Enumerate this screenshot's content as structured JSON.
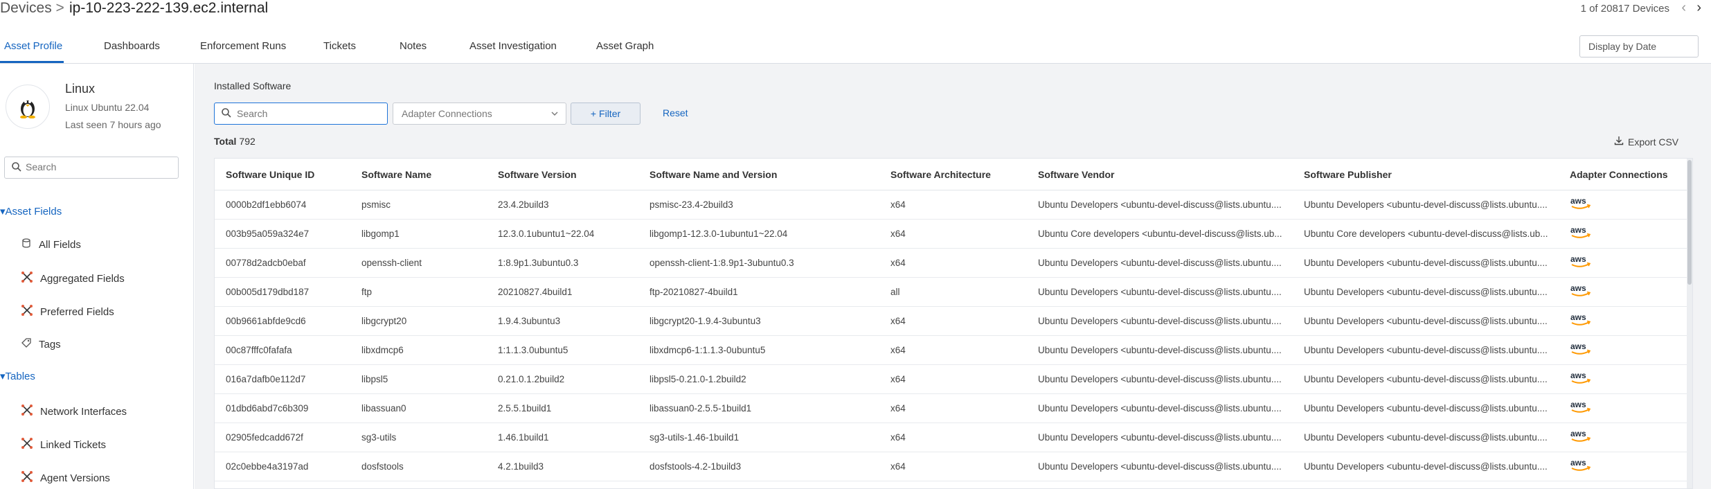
{
  "breadcrumb": {
    "root": "Devices",
    "separator": ">",
    "current": "ip-10-223-222-139.ec2.internal"
  },
  "pager": {
    "text": "1 of 20817 Devices"
  },
  "tabs": [
    {
      "label": "Asset Profile",
      "active": true
    },
    {
      "label": "Dashboards"
    },
    {
      "label": "Enforcement Runs"
    },
    {
      "label": "Tickets"
    },
    {
      "label": "Notes"
    },
    {
      "label": "Asset Investigation"
    },
    {
      "label": "Asset Graph"
    }
  ],
  "date_button": "Display by Date",
  "device": {
    "os_name": "Linux",
    "os_version": "Linux Ubuntu 22.04",
    "last_seen": "Last seen 7 hours ago"
  },
  "sidebar": {
    "search_placeholder": "Search",
    "sections": [
      {
        "title": "Asset Fields",
        "items": [
          {
            "label": "All Fields",
            "icon": "database-icon"
          },
          {
            "label": "Aggregated Fields",
            "icon": "adapters-icon"
          },
          {
            "label": "Preferred Fields",
            "icon": "adapters-icon"
          },
          {
            "label": "Tags",
            "icon": "tag-icon"
          }
        ]
      },
      {
        "title": "Tables",
        "items": [
          {
            "label": "Network Interfaces",
            "icon": "adapters-icon"
          },
          {
            "label": "Linked Tickets",
            "icon": "adapters-icon"
          },
          {
            "label": "Agent Versions",
            "icon": "adapters-icon"
          }
        ]
      }
    ]
  },
  "panel": {
    "title": "Installed Software",
    "search_placeholder": "Search",
    "adapter_select": "Adapter Connections",
    "filter_label": "Filter",
    "reset_label": "Reset",
    "total_label": "Total",
    "total_value": "792",
    "export_label": "Export CSV"
  },
  "table": {
    "columns": [
      "Software Unique ID",
      "Software Name",
      "Software Version",
      "Software Name and Version",
      "Software Architecture",
      "Software Vendor",
      "Software Publisher",
      "Adapter Connections"
    ],
    "rows": [
      [
        "0000b2df1ebb6074",
        "psmisc",
        "23.4.2build3",
        "psmisc-23.4-2build3",
        "x64",
        "Ubuntu Developers <ubuntu-devel-discuss@lists.ubuntu....",
        "Ubuntu Developers <ubuntu-devel-discuss@lists.ubuntu....",
        "aws"
      ],
      [
        "003b95a059a324e7",
        "libgomp1",
        "12.3.0.1ubuntu1~22.04",
        "libgomp1-12.3.0-1ubuntu1~22.04",
        "x64",
        "Ubuntu Core developers <ubuntu-devel-discuss@lists.ub...",
        "Ubuntu Core developers <ubuntu-devel-discuss@lists.ub...",
        "aws"
      ],
      [
        "00778d2adcb0ebaf",
        "openssh-client",
        "1:8.9p1.3ubuntu0.3",
        "openssh-client-1:8.9p1-3ubuntu0.3",
        "x64",
        "Ubuntu Developers <ubuntu-devel-discuss@lists.ubuntu....",
        "Ubuntu Developers <ubuntu-devel-discuss@lists.ubuntu....",
        "aws"
      ],
      [
        "00b005d179dbd187",
        "ftp",
        "20210827.4build1",
        "ftp-20210827-4build1",
        "all",
        "Ubuntu Developers <ubuntu-devel-discuss@lists.ubuntu....",
        "Ubuntu Developers <ubuntu-devel-discuss@lists.ubuntu....",
        "aws"
      ],
      [
        "00b9661abfde9cd6",
        "libgcrypt20",
        "1.9.4.3ubuntu3",
        "libgcrypt20-1.9.4-3ubuntu3",
        "x64",
        "Ubuntu Developers <ubuntu-devel-discuss@lists.ubuntu....",
        "Ubuntu Developers <ubuntu-devel-discuss@lists.ubuntu....",
        "aws"
      ],
      [
        "00c87fffc0fafafa",
        "libxdmcp6",
        "1:1.1.3.0ubuntu5",
        "libxdmcp6-1:1.1.3-0ubuntu5",
        "x64",
        "Ubuntu Developers <ubuntu-devel-discuss@lists.ubuntu....",
        "Ubuntu Developers <ubuntu-devel-discuss@lists.ubuntu....",
        "aws"
      ],
      [
        "016a7dafb0e112d7",
        "libpsl5",
        "0.21.0.1.2build2",
        "libpsl5-0.21.0-1.2build2",
        "x64",
        "Ubuntu Developers <ubuntu-devel-discuss@lists.ubuntu....",
        "Ubuntu Developers <ubuntu-devel-discuss@lists.ubuntu....",
        "aws"
      ],
      [
        "01dbd6abd7c6b309",
        "libassuan0",
        "2.5.5.1build1",
        "libassuan0-2.5.5-1build1",
        "x64",
        "Ubuntu Developers <ubuntu-devel-discuss@lists.ubuntu....",
        "Ubuntu Developers <ubuntu-devel-discuss@lists.ubuntu....",
        "aws"
      ],
      [
        "02905fedcadd672f",
        "sg3-utils",
        "1.46.1build1",
        "sg3-utils-1.46-1build1",
        "x64",
        "Ubuntu Developers <ubuntu-devel-discuss@lists.ubuntu....",
        "Ubuntu Developers <ubuntu-devel-discuss@lists.ubuntu....",
        "aws"
      ],
      [
        "02c0ebbe4a3197ad",
        "dosfstools",
        "4.2.1build3",
        "dosfstools-4.2-1build3",
        "x64",
        "Ubuntu Developers <ubuntu-devel-discuss@lists.ubuntu....",
        "Ubuntu Developers <ubuntu-devel-discuss@lists.ubuntu....",
        "aws"
      ]
    ]
  }
}
